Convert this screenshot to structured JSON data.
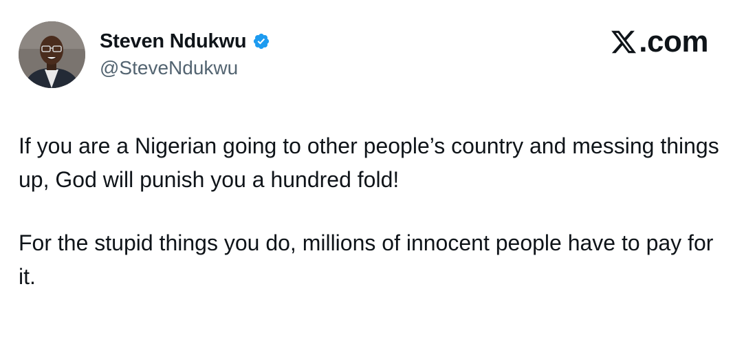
{
  "tweet": {
    "author": {
      "display_name": "Steven Ndukwu",
      "handle": "@SteveNdukwu",
      "verified": true,
      "avatar": "profile-photo"
    },
    "brand": {
      "label": ".com",
      "icon": "x-logo-icon"
    },
    "paragraphs": [
      "If you are a Nigerian going to other people’s country and messing things up, God will punish you a hundred fold!",
      "For the stupid things you do, millions of innocent people have to pay for it."
    ]
  },
  "colors": {
    "text": "#0f1419",
    "secondary_text": "#536471",
    "verified_badge": "#1d9bf0",
    "background": "#ffffff"
  }
}
